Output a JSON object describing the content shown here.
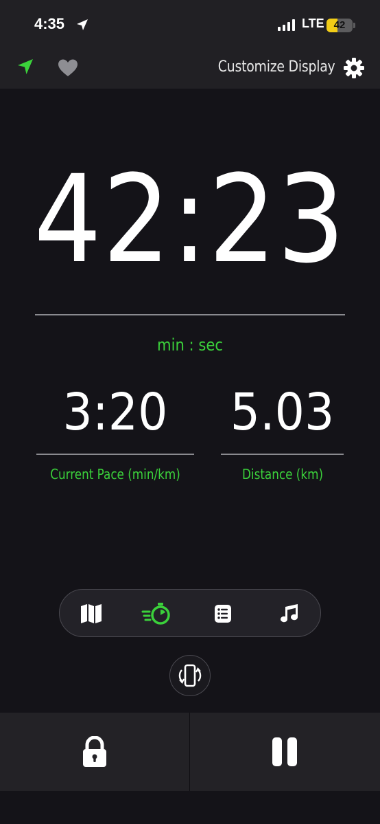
{
  "status_bar": {
    "time": "4:35",
    "network": "LTE",
    "battery_level": 42,
    "battery_text": "42"
  },
  "top_bar": {
    "customize_label": "Customize Display"
  },
  "workout": {
    "elapsed_time": "42:23",
    "elapsed_unit": "min : sec",
    "pace_value": "3:20",
    "pace_label": "Current Pace (min/km)",
    "distance_value": "5.03",
    "distance_label": "Distance (km)"
  },
  "tabs": {
    "items": [
      "map-icon",
      "stopwatch-icon",
      "list-icon",
      "music-icon"
    ],
    "active": "stopwatch-icon"
  },
  "colors": {
    "accent": "#3bd13b",
    "background": "#141318",
    "bar": "#212024"
  }
}
